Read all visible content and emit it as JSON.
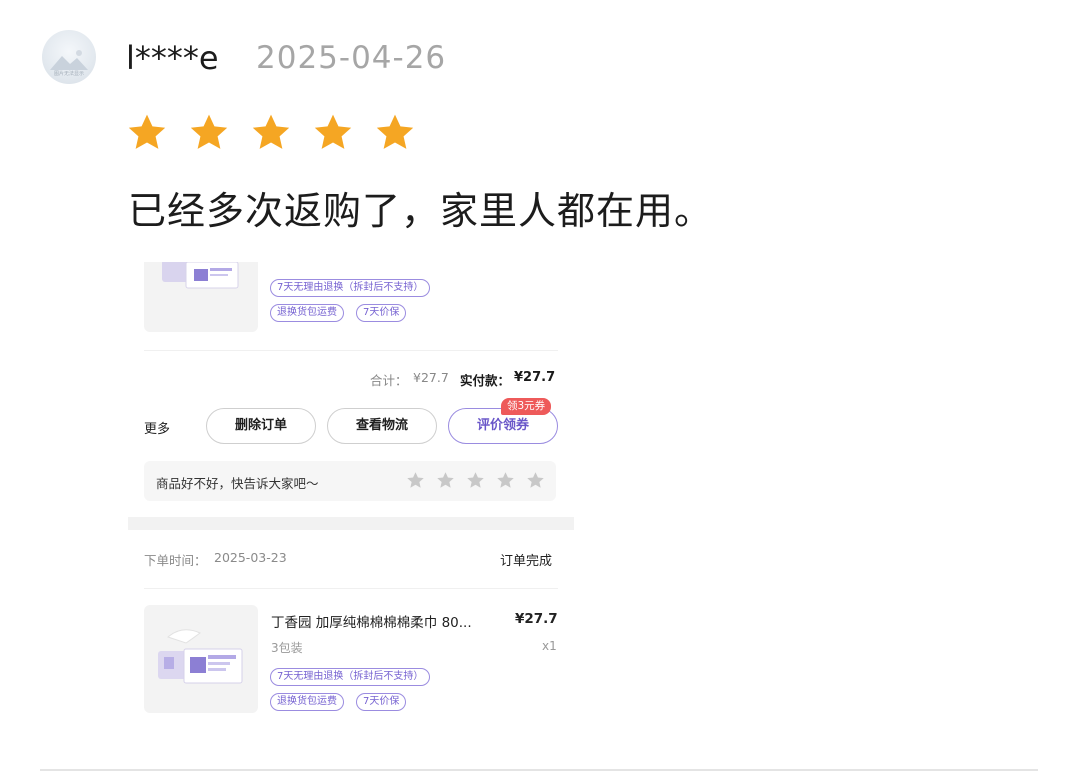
{
  "review": {
    "username": "l****e",
    "date": "2025-04-26",
    "rating": 5,
    "rating_max": 5,
    "star_color": "#f5a623",
    "text": "已经多次返购了，家里人都在用。",
    "avatar_caption": "图片无法显示"
  },
  "screenshot": {
    "top_item": {
      "tags": [
        "7天无理由退换（拆封后不支持）",
        "退换货包运费",
        "7天价保"
      ]
    },
    "summary": {
      "total_label": "合计：",
      "total_value": "¥27.7",
      "paid_label": "实付款：",
      "paid_value": "¥27.7"
    },
    "actions": {
      "more": "更多",
      "delete_order": "删除订单",
      "view_logistics": "查看物流",
      "review_coupon": "评价领券",
      "coupon_badge": "领3元券"
    },
    "rate_prompt": {
      "text": "商品好不好，快告诉大家吧～",
      "stars": 5,
      "star_color": "#c8c8c8"
    },
    "order": {
      "time_label": "下单时间：",
      "time": "2025-03-23",
      "status": "订单完成",
      "product_title": "丁香园 加厚纯棉棉棉棉柔巾 80...",
      "price": "¥27.7",
      "spec": "3包装",
      "qty": "x1",
      "tags": [
        "7天无理由退换（拆封后不支持）",
        "退换货包运费",
        "7天价保"
      ]
    }
  },
  "colors": {
    "accent": "#6a57c9",
    "tag_border": "#9b8ce0",
    "coupon": "#ee5a5a"
  }
}
